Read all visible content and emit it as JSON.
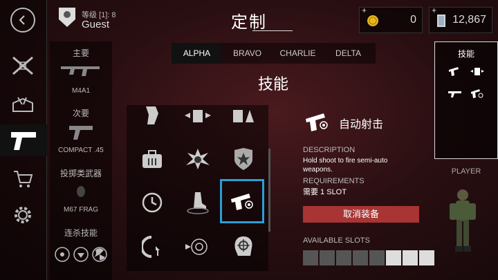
{
  "header": {
    "title": "定制",
    "user": {
      "level_label": "等级 [1]: 8",
      "name": "Guest"
    },
    "currency": [
      {
        "plus": "+",
        "icon": "gold-coin-icon",
        "value": "0"
      },
      {
        "plus": "+",
        "icon": "cash-stack-icon",
        "value": "12,867"
      }
    ]
  },
  "sidebar": {
    "items": [
      {
        "icon": "back-arrow-icon"
      },
      {
        "icon": "crossed-rifles-icon"
      },
      {
        "icon": "ammo-crate-icon"
      },
      {
        "icon": "pistol-icon",
        "active": true
      },
      {
        "icon": "shopping-cart-icon"
      },
      {
        "icon": "gear-icon"
      }
    ]
  },
  "loadout": {
    "primary_header": "主要",
    "primary_name": "M4A1",
    "secondary_header": "次要",
    "secondary_name": "COMPACT .45",
    "throwable_header": "投掷类武器",
    "throwable_name": "M67 FRAG",
    "killstreak_header": "连杀技能"
  },
  "tabs": [
    "ALPHA",
    "BRAVO",
    "CHARLIE",
    "DELTA"
  ],
  "active_tab": "ALPHA",
  "section_title": "技能",
  "skills": [
    {
      "icon": "hand-grip-icon"
    },
    {
      "icon": "armor-swap-icon"
    },
    {
      "icon": "armor-break-icon"
    },
    {
      "icon": "ammo-pouch-icon"
    },
    {
      "icon": "grenade-blast-icon"
    },
    {
      "icon": "blast-shield-icon"
    },
    {
      "icon": "clock-icon"
    },
    {
      "icon": "quiet-step-icon"
    },
    {
      "icon": "semi-auto-pistol-icon",
      "selected": true
    },
    {
      "icon": "fast-reload-icon"
    },
    {
      "icon": "radar-target-icon"
    },
    {
      "icon": "head-target-icon"
    }
  ],
  "detail": {
    "name": "自动射击",
    "description_label": "DESCRIPTION",
    "description_line1": "Hold shoot to fire semi-auto",
    "description_line2": "weapons.",
    "requirements_label": "REQUIREMENTS",
    "requirements_value": "需要 1 SLOT",
    "unequip_label": "取消装备",
    "slots_label": "AVAILABLE SLOTS",
    "slots_total": 8,
    "slots_free": 3
  },
  "right_panel": {
    "title": "技能",
    "player_label": "PLAYER"
  },
  "colors": {
    "accent_blue": "#2a9fd6",
    "unequip_red": "#a83434",
    "gold": "#e8b820"
  }
}
